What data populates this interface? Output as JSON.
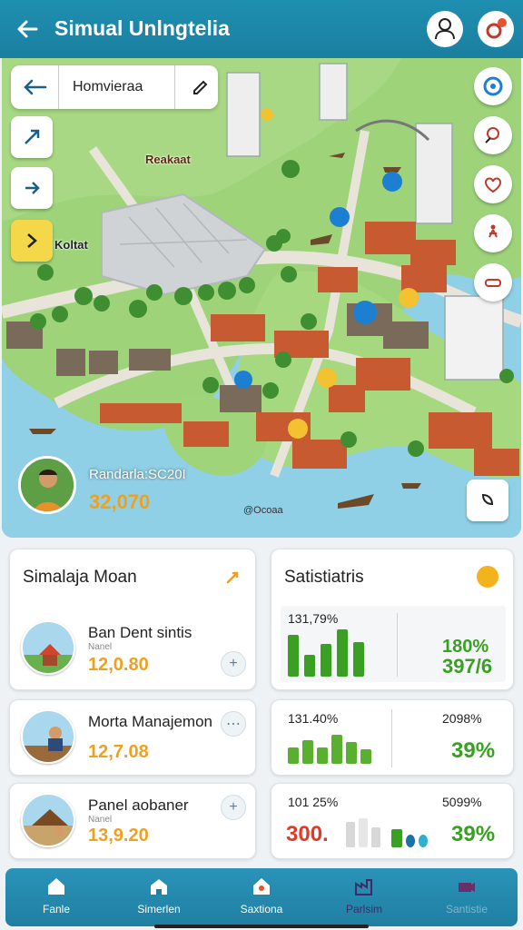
{
  "header": {
    "title": "Simual Unlngtelia"
  },
  "map": {
    "search_text": "Homvieraa",
    "labels": {
      "area_top": "Reakaat",
      "area_left": "Koltat",
      "watermark": "@Ocoaa"
    },
    "player": {
      "name": "Randarla:SC20I",
      "value": "32,070"
    }
  },
  "left_card": {
    "title": "Simalaja Moan",
    "items": [
      {
        "name": "Ban Dent sintis",
        "sub": "Nanel",
        "price": "12,0.80"
      },
      {
        "name": "Morta Manajemon",
        "sub": "",
        "price": "12,7.08"
      },
      {
        "name": "Panel aobaner",
        "sub": "Nanel",
        "price": "13,9.20"
      }
    ]
  },
  "stats": {
    "title": "Satistiatris",
    "panels": [
      {
        "left": "131,79%",
        "right_top": "",
        "big_top": "180%",
        "big": "397/6"
      },
      {
        "left": "131.40%",
        "right_top": "2098%",
        "big": "39%"
      },
      {
        "left": "101 25%",
        "right_top": "5099%",
        "red": "300.",
        "big": "39%"
      }
    ]
  },
  "nav": {
    "items": [
      {
        "label": "Fanle"
      },
      {
        "label": "Simerlen"
      },
      {
        "label": "Saxtiona"
      },
      {
        "label": "Parlsim"
      },
      {
        "label": "Santistie"
      }
    ]
  },
  "colors": {
    "header": "#1f8fb0",
    "accent_orange": "#f0a020",
    "accent_green": "#3aa024",
    "accent_red": "#e03a2a"
  }
}
